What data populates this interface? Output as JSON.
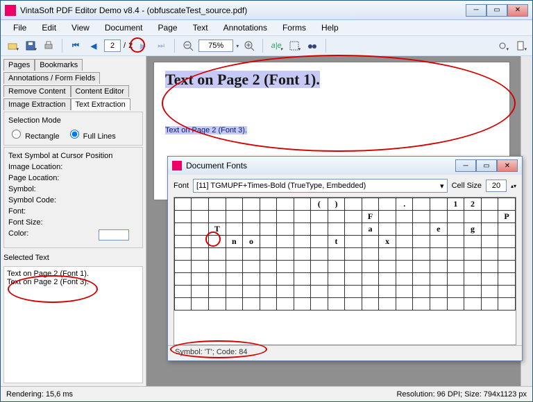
{
  "window": {
    "title": "VintaSoft PDF Editor Demo v8.4 -  (obfuscateTest_source.pdf)"
  },
  "menu": {
    "items": [
      "File",
      "Edit",
      "View",
      "Document",
      "Page",
      "Text",
      "Annotations",
      "Forms",
      "Help"
    ]
  },
  "toolbar": {
    "page_current": "2",
    "page_sep": "/",
    "page_total": "2",
    "zoom": "75%"
  },
  "side_tabs": {
    "row1": [
      "Pages",
      "Bookmarks"
    ],
    "row2": [
      "Annotations / Form Fields"
    ],
    "row3": [
      "Remove Content",
      "Content Editor"
    ],
    "row4": [
      "Image Extraction",
      "Text Extraction"
    ],
    "active": "Text Extraction"
  },
  "selection_mode": {
    "title": "Selection Mode",
    "rect": "Rectangle",
    "full": "Full Lines",
    "checked": "full"
  },
  "cursor_panel": {
    "title": "Text Symbol at Cursor Position",
    "labels": {
      "image_loc": "Image Location:",
      "page_loc": "Page Location:",
      "symbol": "Symbol:",
      "symbol_code": "Symbol Code:",
      "font": "Font:",
      "font_size": "Font Size:",
      "color": "Color:"
    }
  },
  "selected_text": {
    "title": "Selected Text",
    "lines": [
      "Text on Page 2 (Font 1).",
      "Text on Page 2 (Font 3)."
    ]
  },
  "page_content": {
    "line1": "Text on Page 2 (Font 1).",
    "line3": "Text on Page 2 (Font 3)."
  },
  "doc_fonts": {
    "title": "Document Fonts",
    "font_label": "Font",
    "font_value": "[11] TGMUPF+Times-Bold (TrueType, Embedded)",
    "cell_label": "Cell Size",
    "cell_value": "20",
    "status": "Symbol: 'T'; Code: 84",
    "grid": [
      [
        "",
        "",
        "",
        "",
        "",
        "",
        "",
        "",
        "(",
        ")",
        "",
        "",
        "",
        ".",
        "",
        "",
        "1",
        "2",
        "",
        ""
      ],
      [
        "",
        "",
        "",
        "",
        "",
        "",
        "",
        "",
        "",
        "",
        "",
        "F",
        "",
        "",
        "",
        "",
        "",
        "",
        "",
        "P"
      ],
      [
        "",
        "",
        "T",
        "",
        "",
        "",
        "",
        "",
        "",
        "",
        "",
        "a",
        "",
        "",
        "",
        "e",
        "",
        "g",
        "",
        ""
      ],
      [
        "",
        "",
        "",
        "n",
        "o",
        "",
        "",
        "",
        "",
        "t",
        "",
        "",
        "x",
        "",
        "",
        "",
        "",
        "",
        "",
        ""
      ],
      [
        "",
        "",
        "",
        "",
        "",
        "",
        "",
        "",
        "",
        "",
        "",
        "",
        "",
        "",
        "",
        "",
        "",
        "",
        "",
        ""
      ],
      [
        "",
        "",
        "",
        "",
        "",
        "",
        "",
        "",
        "",
        "",
        "",
        "",
        "",
        "",
        "",
        "",
        "",
        "",
        "",
        ""
      ],
      [
        "",
        "",
        "",
        "",
        "",
        "",
        "",
        "",
        "",
        "",
        "",
        "",
        "",
        "",
        "",
        "",
        "",
        "",
        "",
        ""
      ],
      [
        "",
        "",
        "",
        "",
        "",
        "",
        "",
        "",
        "",
        "",
        "",
        "",
        "",
        "",
        "",
        "",
        "",
        "",
        "",
        ""
      ],
      [
        "",
        "",
        "",
        "",
        "",
        "",
        "",
        "",
        "",
        "",
        "",
        "",
        "",
        "",
        "",
        "",
        "",
        "",
        "",
        ""
      ]
    ]
  },
  "statusbar": {
    "left": "Rendering: 15,6 ms",
    "right": "Resolution: 96 DPI; Size: 794x1123 px"
  }
}
